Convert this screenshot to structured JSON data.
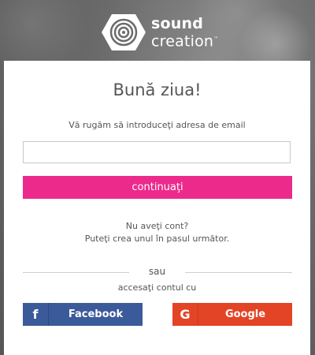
{
  "brand": {
    "line1": "sound",
    "line2": "creation",
    "trademark": "™"
  },
  "card": {
    "title": "Bună ziua!",
    "email_prompt": "Vă rugăm să introduceţi adresa de email",
    "email_value": "",
    "email_placeholder": "",
    "continue_label": "continuaţi",
    "no_account_line1": "Nu aveţi cont?",
    "no_account_line2": "Puteţi crea unul în pasul următor.",
    "or_label": "sau",
    "access_label": "accesaţi contul cu",
    "facebook_label": "Facebook",
    "facebook_icon": "facebook-icon",
    "google_label": "Google",
    "google_icon": "google-icon"
  },
  "colors": {
    "accent": "#ec2a8c",
    "facebook": "#3b5a9a",
    "google": "#e34426"
  }
}
